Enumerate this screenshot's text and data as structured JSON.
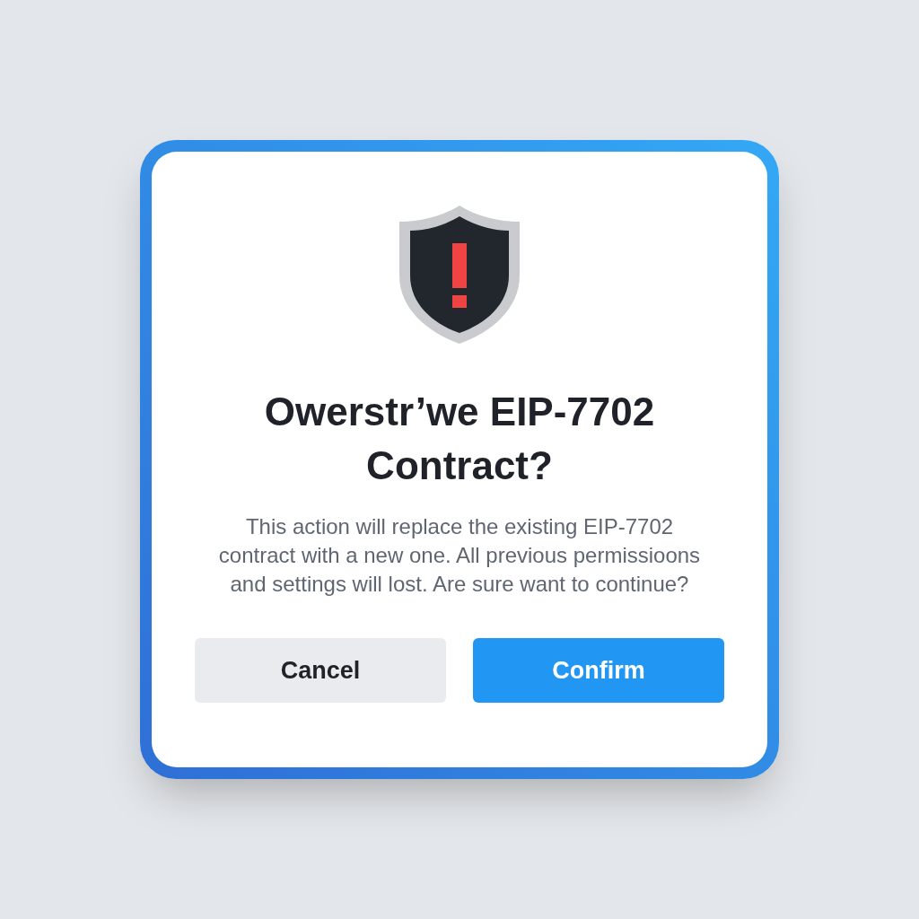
{
  "dialog": {
    "title": "Owerstr’we EIP-7702 Contract?",
    "message": "This action will replace the existing EIP-7702 contract with a new one. All previous permissioons and settings will lost. Are sure want to continue?",
    "buttons": [
      {
        "label": "Cancel",
        "kind": "secondary"
      },
      {
        "label": "Confirm",
        "kind": "primary"
      }
    ]
  }
}
